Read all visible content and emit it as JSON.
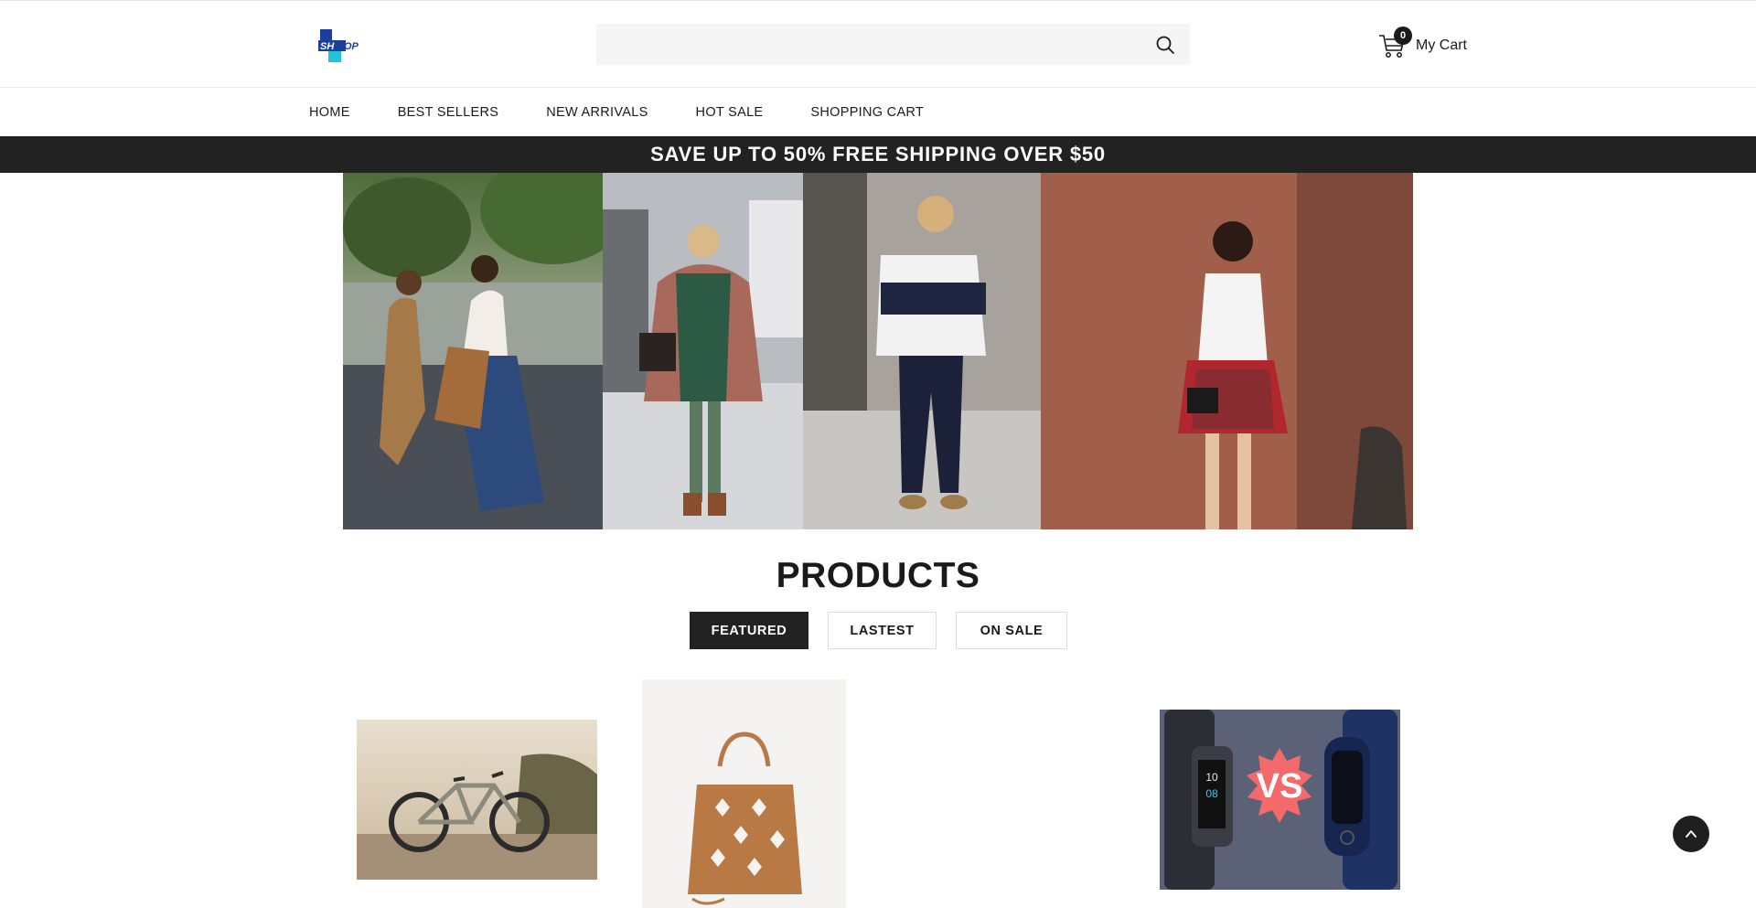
{
  "header": {
    "logo_text_left": "SH",
    "logo_text_right": "OP",
    "search": {
      "placeholder": "",
      "value": ""
    },
    "cart": {
      "count": "0",
      "label": "My Cart"
    }
  },
  "nav": {
    "items": [
      {
        "label": "HOME"
      },
      {
        "label": "BEST SELLERS"
      },
      {
        "label": "NEW ARRIVALS"
      },
      {
        "label": "HOT SALE"
      },
      {
        "label": "SHOPPING CART"
      }
    ]
  },
  "promo": {
    "text": "SAVE UP TO 50% FREE SHIPPING OVER $50"
  },
  "products": {
    "title": "PRODUCTS",
    "tabs": [
      {
        "label": "FEATURED",
        "active": true
      },
      {
        "label": "LASTEST",
        "active": false
      },
      {
        "label": "ON SALE",
        "active": false
      }
    ],
    "smartband_badge": "VS",
    "smartband_screen_text": [
      "10",
      "08"
    ]
  },
  "colors": {
    "accent_dark": "#222222",
    "logo_blue": "#1a3f9c",
    "logo_cyan": "#22c3d6",
    "vs_red": "#f46a6a"
  },
  "icons": {
    "search": "magnifier",
    "cart": "shopping-cart",
    "back_to_top": "chevron-up"
  }
}
